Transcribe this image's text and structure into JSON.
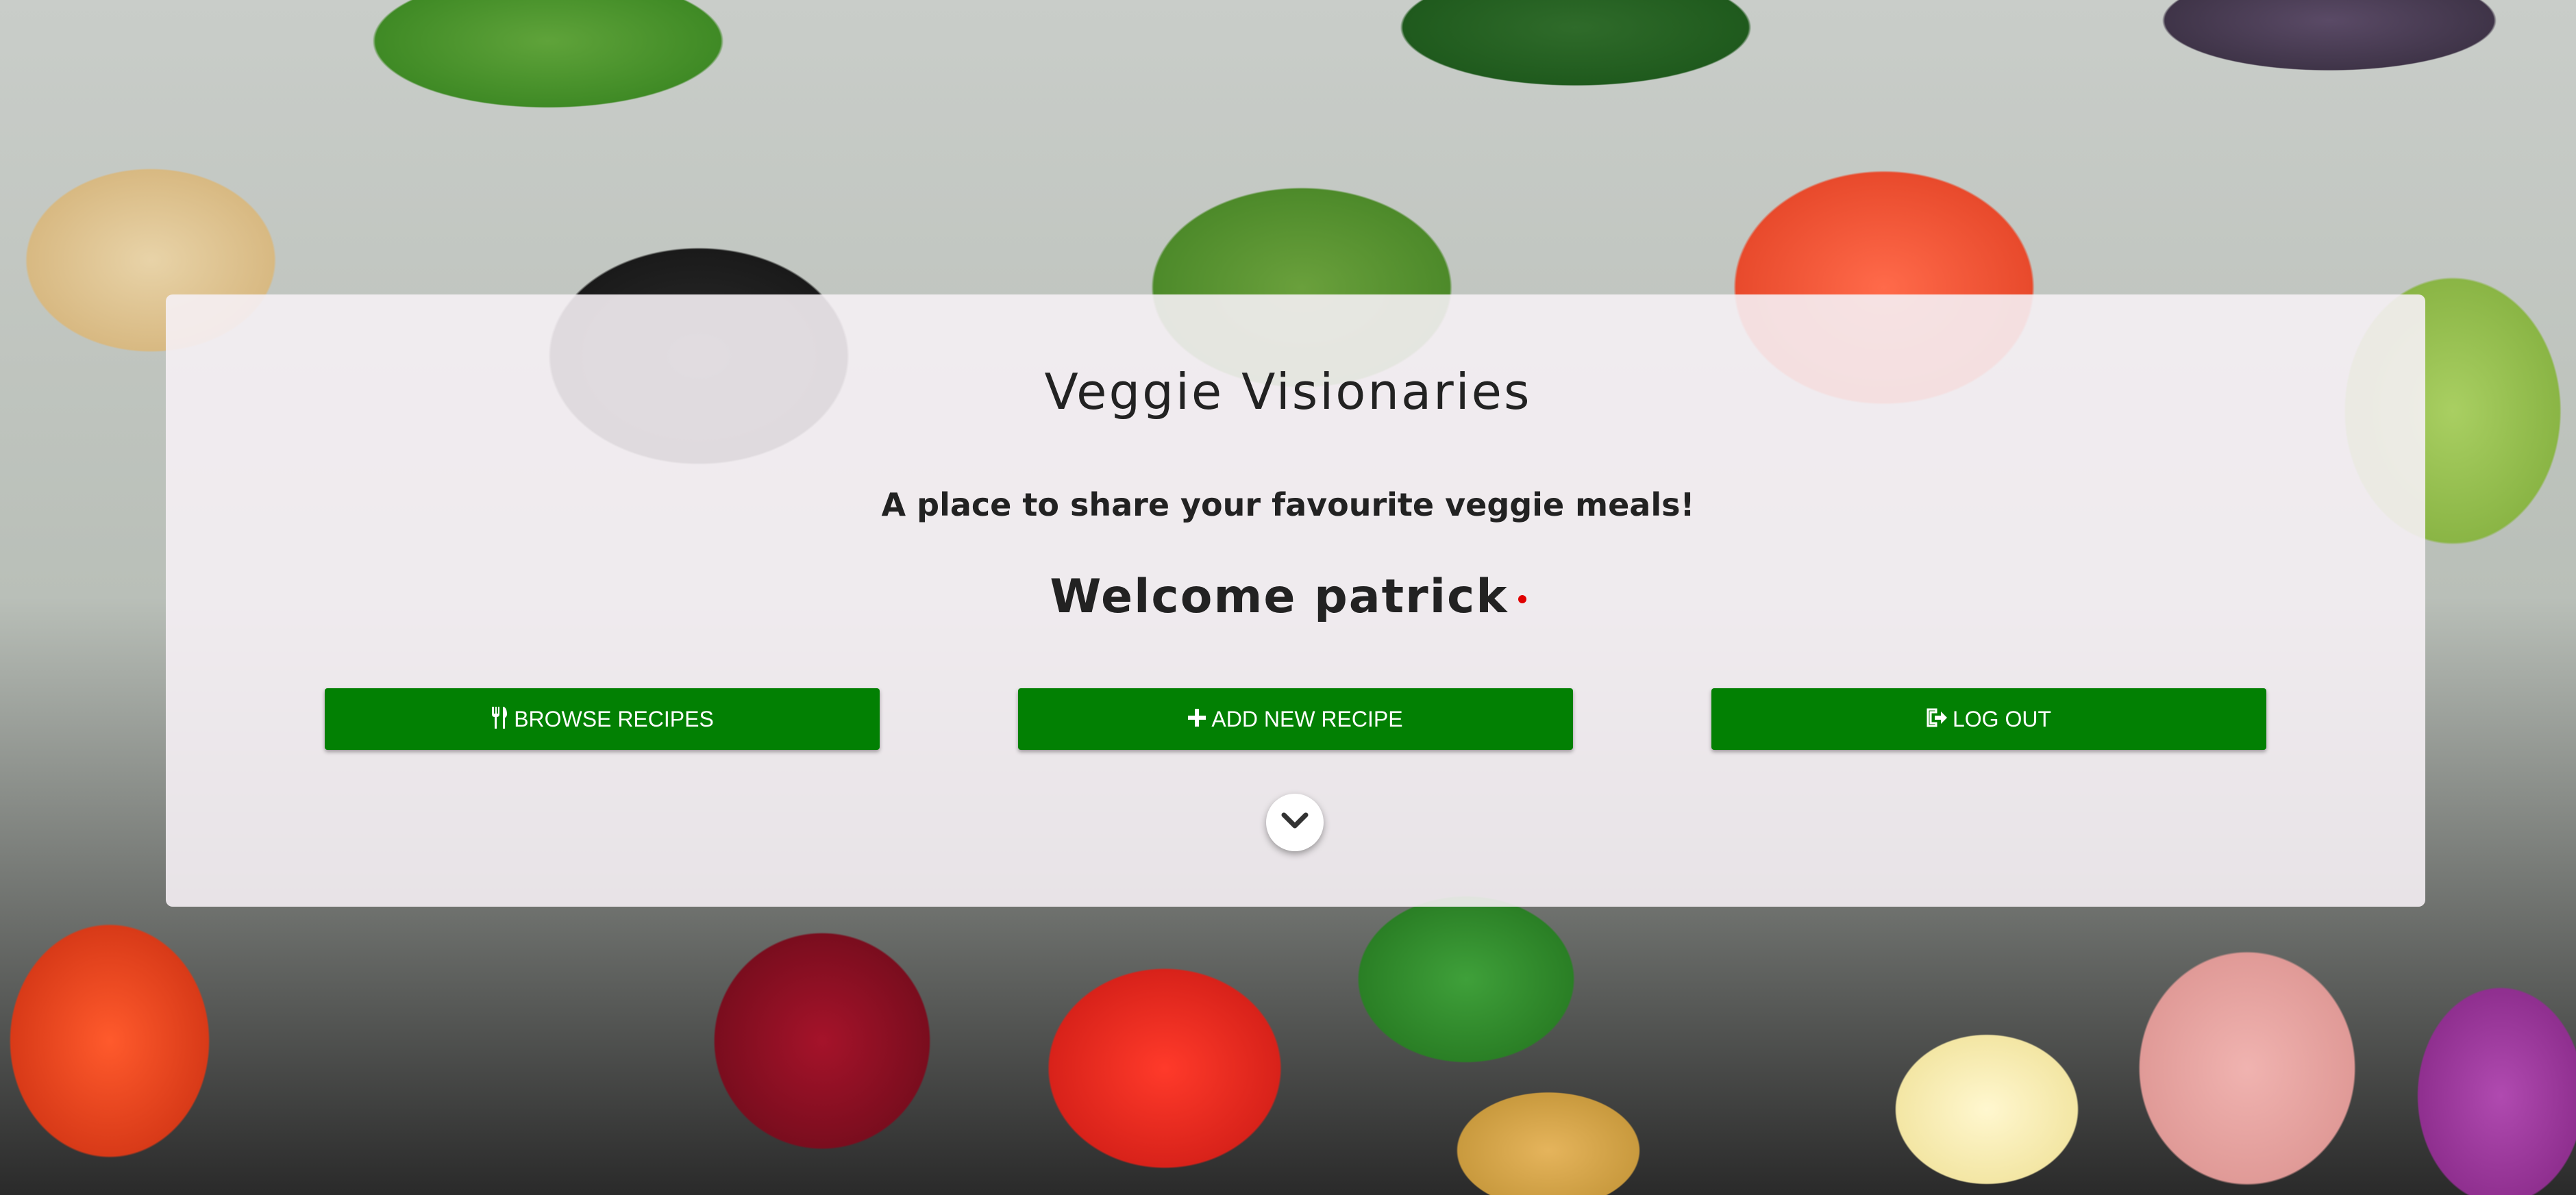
{
  "header": {
    "title": "Veggie Visionaries",
    "subtitle": "A place to share your favourite veggie meals!",
    "welcome": "Welcome patrick"
  },
  "actions": {
    "browse_label": "BROWSE RECIPES",
    "browse_icon": "utensils-icon",
    "add_label": "ADD NEW RECIPE",
    "add_icon": "plus-icon",
    "logout_label": "LOG OUT",
    "logout_icon": "sign-out-icon"
  },
  "scroll": {
    "icon": "chevron-down-icon"
  },
  "colors": {
    "button": "#028003",
    "panel": "#f5f0f4",
    "accent_dot": "#e00000"
  }
}
